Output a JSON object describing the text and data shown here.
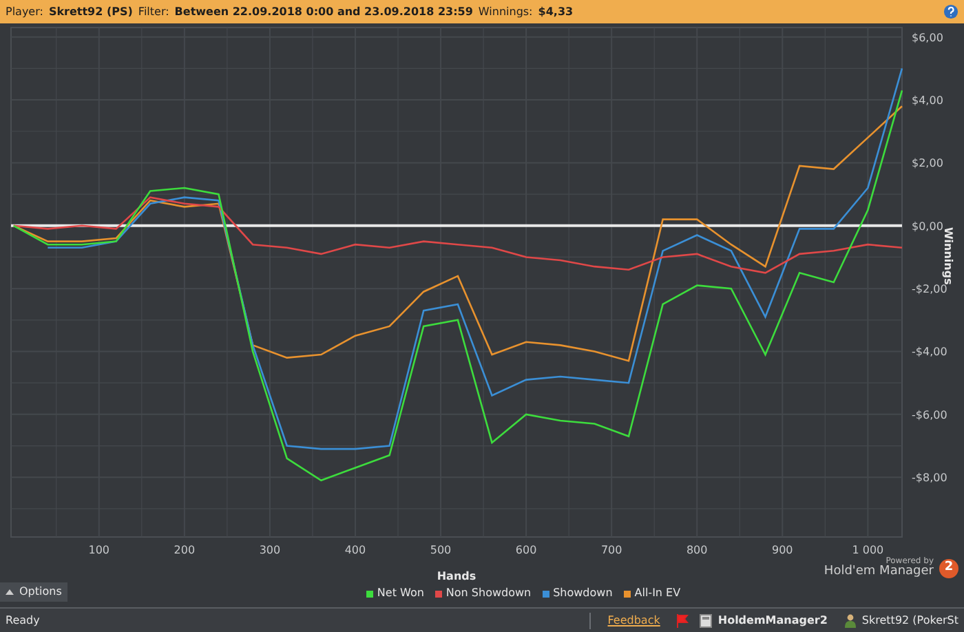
{
  "header": {
    "player_label": "Player:",
    "player": "Skrett92 (PS)",
    "filter_label": "Filter:",
    "filter": "Between 22.09.2018 0:00 and 23.09.2018 23:59",
    "winnings_label": "Winnings:",
    "winnings": "$4,33"
  },
  "chart": {
    "chart_data": {
      "type": "line",
      "grid": true,
      "xlabel": "Hands",
      "ylabel": "Winnings",
      "xlim": [
        -3,
        1040
      ],
      "ylim": [
        -9.9,
        6.3
      ],
      "xticks": [
        {
          "value": 100,
          "label": "100"
        },
        {
          "value": 200,
          "label": "200"
        },
        {
          "value": 300,
          "label": "300"
        },
        {
          "value": 400,
          "label": "400"
        },
        {
          "value": 500,
          "label": "500"
        },
        {
          "value": 600,
          "label": "600"
        },
        {
          "value": 700,
          "label": "700"
        },
        {
          "value": 800,
          "label": "800"
        },
        {
          "value": 900,
          "label": "900"
        },
        {
          "value": 1000,
          "label": "1 000"
        }
      ],
      "yticks": [
        {
          "value": 6,
          "label": "$6,00"
        },
        {
          "value": 4,
          "label": "$4,00"
        },
        {
          "value": 2,
          "label": "$2,00"
        },
        {
          "value": 0,
          "label": "$0,00"
        },
        {
          "value": -2,
          "label": "-$2,00"
        },
        {
          "value": -4,
          "label": "-$4,00"
        },
        {
          "value": -6,
          "label": "-$6,00"
        },
        {
          "value": -8,
          "label": "-$8,00"
        }
      ],
      "x": [
        0,
        40,
        80,
        120,
        160,
        200,
        240,
        280,
        320,
        360,
        400,
        440,
        480,
        520,
        560,
        600,
        640,
        680,
        720,
        760,
        800,
        840,
        880,
        920,
        960,
        1000,
        1040
      ],
      "series": [
        {
          "name": "Net Won",
          "color": "#3ddc3d",
          "values": [
            0,
            -0.6,
            -0.6,
            -0.5,
            1.1,
            1.2,
            1.0,
            -4.0,
            -7.4,
            -8.1,
            -7.7,
            -7.3,
            -3.2,
            -3.0,
            -6.9,
            -6.0,
            -6.2,
            -6.3,
            -6.7,
            -2.5,
            -1.9,
            -2.0,
            -4.1,
            -1.5,
            -1.8,
            0.5,
            4.3
          ]
        },
        {
          "name": "Non Showdown",
          "color": "#e04848",
          "values": [
            0,
            -0.1,
            0,
            -0.1,
            0.9,
            0.7,
            0.6,
            -0.6,
            -0.7,
            -0.9,
            -0.6,
            -0.7,
            -0.5,
            -0.6,
            -0.7,
            -1.0,
            -1.1,
            -1.3,
            -1.4,
            -1.0,
            -0.9,
            -1.3,
            -1.5,
            -0.9,
            -0.8,
            -0.6,
            -0.7
          ]
        },
        {
          "name": "Showdown",
          "color": "#3b8fd6",
          "values": [
            null,
            -0.7,
            -0.7,
            -0.5,
            0.7,
            0.9,
            0.8,
            -3.8,
            -7.0,
            -7.1,
            -7.1,
            -7.0,
            -2.7,
            -2.5,
            -5.4,
            -4.9,
            -4.8,
            -4.9,
            -5.0,
            -0.8,
            -0.3,
            -0.8,
            -2.9,
            -0.1,
            -0.1,
            1.2,
            5.0
          ]
        },
        {
          "name": "All-In EV",
          "color": "#e8922e",
          "values": [
            0,
            -0.5,
            -0.5,
            -0.4,
            0.8,
            0.6,
            0.7,
            -3.8,
            -4.2,
            -4.1,
            -3.5,
            -3.2,
            -2.1,
            -1.6,
            -4.1,
            -3.7,
            -3.8,
            -4.0,
            -4.3,
            0.2,
            0.2,
            -0.6,
            -1.3,
            1.9,
            1.8,
            2.8,
            3.8
          ]
        }
      ]
    }
  },
  "options_button": {
    "label": "Options"
  },
  "powered_by": {
    "caption": "Powered by",
    "product": "Hold'em Manager",
    "badge": "2"
  },
  "status_bar": {
    "status": "Ready",
    "feedback": "Feedback",
    "items": [
      "HoldemManager2",
      "Skrett92 (PokerSt"
    ]
  }
}
